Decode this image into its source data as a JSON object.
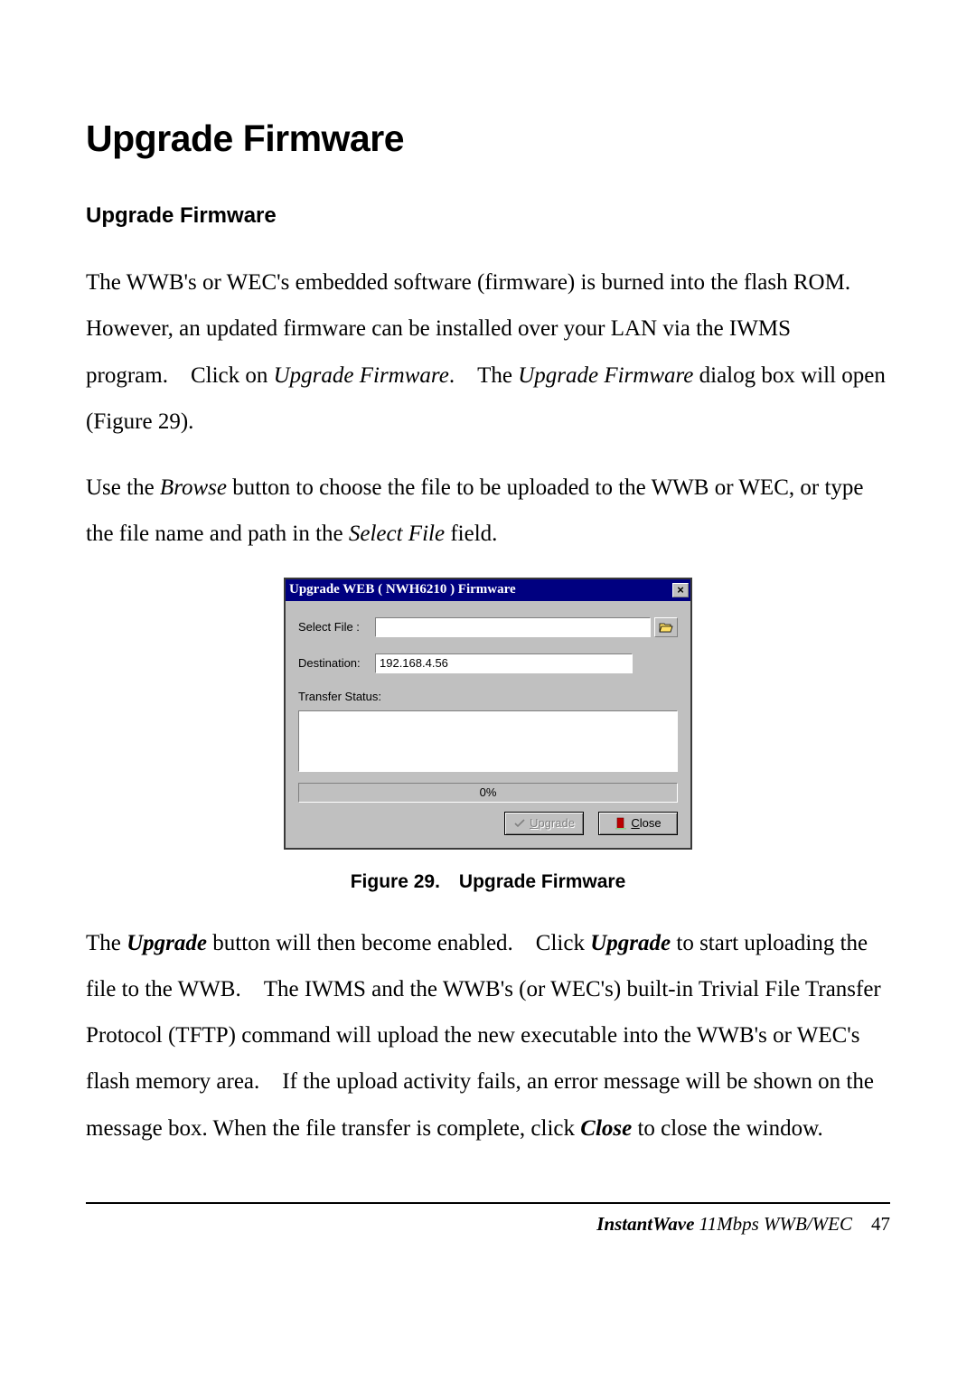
{
  "heading": "Upgrade Firmware",
  "subheading": "Upgrade Firmware",
  "para1": {
    "t1": "The WWB's or WEC's embedded software (firmware) is burned into the flash ROM. However, an updated firmware can be installed over your LAN via the IWMS program. Click on ",
    "i1": "Upgrade Firmware",
    "t2": ". The ",
    "i2": "Upgrade Firmware",
    "t3": " dialog box will open (Figure 29)."
  },
  "para2": {
    "t1": "Use the ",
    "i1": "Browse",
    "t2": " button to choose the file to be uploaded to the WWB or WEC, or type the file name and path in the ",
    "i2": "Select File",
    "t3": " field."
  },
  "dialog": {
    "title": "Upgrade WEB ( NWH6210 ) Firmware",
    "close_glyph": "×",
    "select_file_label": "Select File :",
    "select_file_value": "",
    "destination_label": "Destination:",
    "destination_value": "192.168.4.56",
    "status_label": "Transfer Status:",
    "progress_text": "0%",
    "upgrade_label": "Upgrade",
    "close_label": "Close"
  },
  "figure_caption": "Figure 29. Upgrade Firmware",
  "para3": {
    "t1": "The ",
    "b1": "Upgrade",
    "t2": " button will then become enabled. Click ",
    "b2": "Upgrade",
    "t3": " to start uploading the file to the WWB. The IWMS and the WWB's (or WEC's) built-in Trivial File Transfer Protocol (TFTP) command will upload the new executable into the WWB's or WEC's flash memory area. If the upload activity fails, an error message will be shown on the message box. When the file transfer is complete, click ",
    "b3": "Close",
    "t4": " to close the window."
  },
  "footer": {
    "product": "InstantWave",
    "model": " 11Mbps WWB/WEC ",
    "page": "47"
  }
}
